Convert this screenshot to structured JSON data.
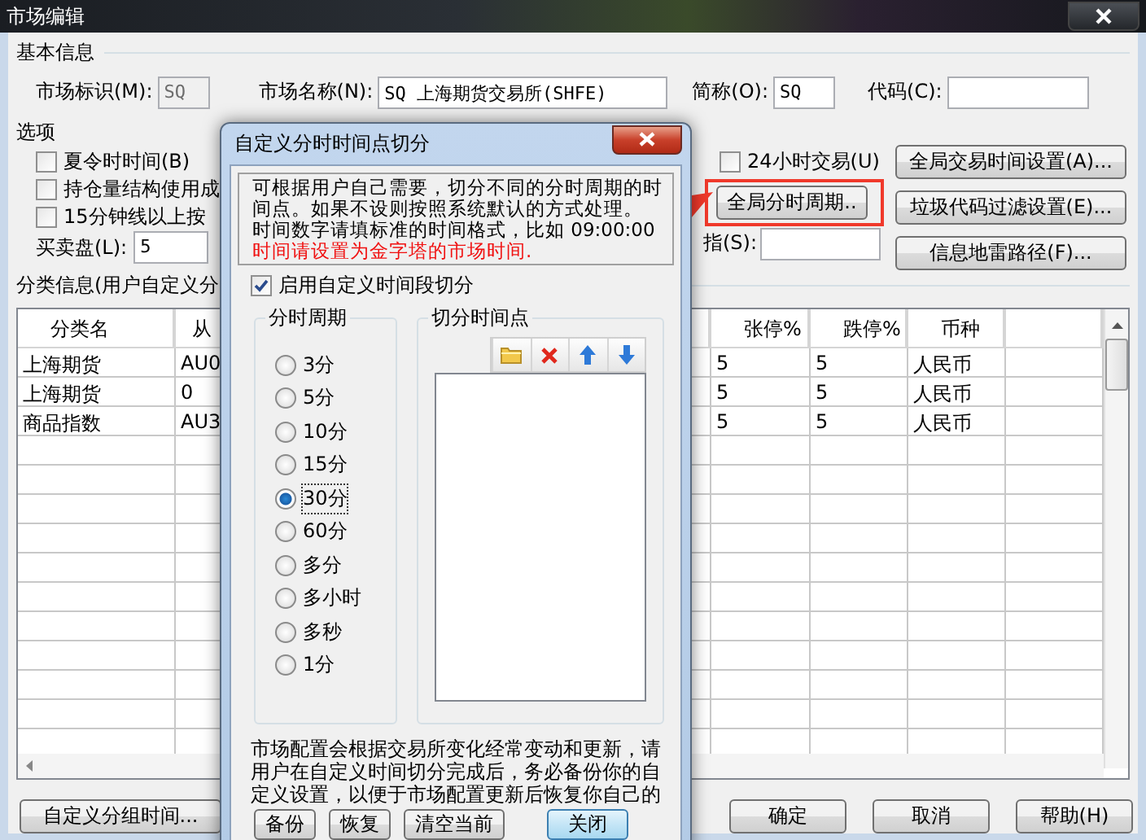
{
  "window": {
    "title": "市场编辑"
  },
  "basic_info": {
    "title": "基本信息",
    "fields": [
      {
        "label": "市场标识(M):",
        "value": "SQ",
        "disabled": true
      },
      {
        "label": "市场名称(N):",
        "value": "SQ 上海期货交易所(SHFE)",
        "disabled": false
      },
      {
        "label": "简称(O):",
        "value": "SQ",
        "disabled": false
      },
      {
        "label": "代码(C):",
        "disabled": false
      }
    ]
  },
  "options": {
    "title": "选项",
    "checkboxes": [
      {
        "label": "夏令时时间(B)",
        "checked": false
      },
      {
        "label": "持仓量结构使用成",
        "checked": false
      },
      {
        "label": "15分钟线以上按",
        "checked": false
      }
    ],
    "depth": {
      "label": "买卖盘(L):",
      "value": "5"
    },
    "all_day": {
      "label": "24小时交易(U)",
      "checked": false
    },
    "period_button": {
      "label": "全局分时周期..",
      "highlighted": true
    },
    "index_field": {
      "label": "指(S):"
    },
    "buttons": [
      "全局交易时间设置(A)...",
      "垃圾代码过滤设置(E)...",
      "信息地雷路径(F)..."
    ]
  },
  "category": {
    "title": "分类信息(用户自定义分",
    "columns": [
      "分类名",
      "从",
      "张停%",
      "跌停%",
      "币种"
    ],
    "rows": [
      [
        "上海期货",
        "AU0",
        "5",
        "5",
        "人民币"
      ],
      [
        "上海期货",
        "0",
        "5",
        "5",
        "人民币"
      ],
      [
        "商品指数",
        "AU3",
        "5",
        "5",
        "人民币"
      ]
    ]
  },
  "footer_buttons": [
    {
      "label": "自定义分组时间...",
      "kind": "left"
    },
    {
      "label": "确定",
      "kind": "right"
    },
    {
      "label": "取消",
      "kind": "right"
    },
    {
      "label": "帮助(H)",
      "kind": "right"
    }
  ],
  "dialog": {
    "title": "自定义分时时间点切分",
    "intro": "可根据用户自己需要，切分不同的分时周期的时间点。如果不设则按照系统默认的方式处理。",
    "hint": "时间数字请填标准的时间格式，比如 09:00:00",
    "warning": "时间请设置为金字塔的市场时间.",
    "enable": {
      "label": "启用自定义时间段切分",
      "checked": true
    },
    "periods": {
      "title": "分时周期",
      "options": [
        {
          "label": "3分",
          "selected": false
        },
        {
          "label": "5分",
          "selected": false
        },
        {
          "label": "10分",
          "selected": false
        },
        {
          "label": "15分",
          "selected": false
        },
        {
          "label": "30分",
          "selected": true
        },
        {
          "label": "60分",
          "selected": false
        },
        {
          "label": "多分",
          "selected": false
        },
        {
          "label": "多小时",
          "selected": false
        },
        {
          "label": "多秒",
          "selected": false
        },
        {
          "label": "1分",
          "selected": false
        }
      ]
    },
    "points": {
      "title": "切分时间点"
    },
    "note": "市场配置会根据交易所变化经常变动和更新，请用户在自定义时间切分完成后，务必备份你的自定义设置，以便于市场配置更新后恢复你自己的",
    "buttons": [
      {
        "label": "备份",
        "default": false
      },
      {
        "label": "恢复",
        "default": false
      },
      {
        "label": "清空当前",
        "default": false
      },
      {
        "label": "关闭",
        "default": true
      }
    ]
  }
}
